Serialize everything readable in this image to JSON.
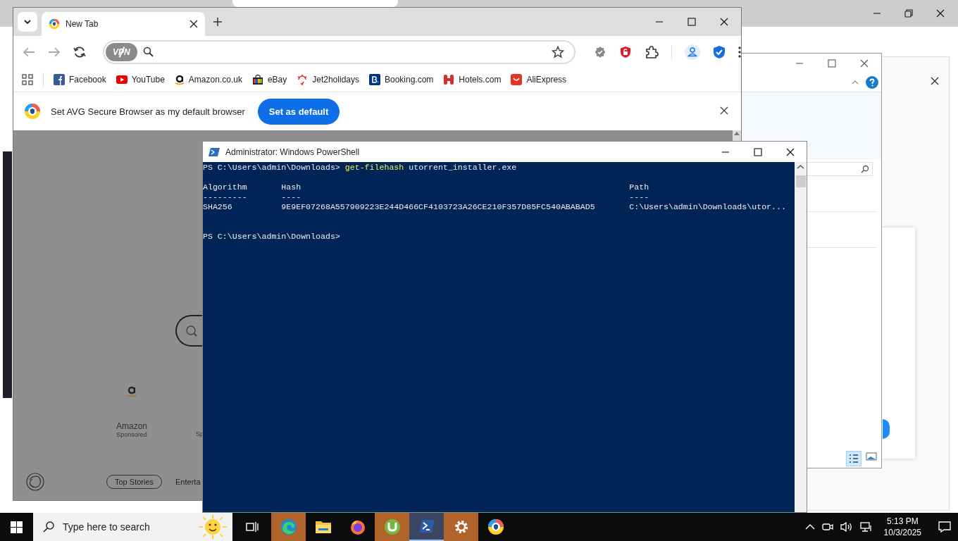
{
  "browser": {
    "tabs": [
      {
        "title": "New Tab",
        "selected": true
      }
    ],
    "vpn_label": "VPN",
    "bookmarks": [
      {
        "kind": "facebook",
        "label": "Facebook"
      },
      {
        "kind": "youtube",
        "label": "YouTube"
      },
      {
        "kind": "amazon",
        "label": "Amazon.co.uk"
      },
      {
        "kind": "ebay",
        "label": "eBay"
      },
      {
        "kind": "jet2",
        "label": "Jet2holidays"
      },
      {
        "kind": "booking",
        "label": "Booking.com"
      },
      {
        "kind": "hotels",
        "label": "Hotels.com"
      },
      {
        "kind": "aliexpress",
        "label": "AliExpress"
      }
    ],
    "infobar": {
      "message": "Set AVG Secure Browser as my default browser",
      "button": "Set as default"
    },
    "newtab": {
      "tiles": [
        {
          "name": "Amazon",
          "note": "Sponsored"
        },
        {
          "note": "Sp"
        }
      ],
      "chips": [
        {
          "label": "Top Stories",
          "selected": true
        },
        {
          "label": "Enterta",
          "selected": false
        }
      ]
    }
  },
  "powershell": {
    "title": "Administrator: Windows PowerShell",
    "command": {
      "prompt": "PS C:\\Users\\admin\\Downloads> ",
      "cmdlet": "get-filehash",
      "args": " utorrent_installer.exe"
    },
    "columns": [
      {
        "header": "Algorithm",
        "rule": "---------"
      },
      {
        "header": "Hash",
        "rule": "----"
      },
      {
        "header": "Path",
        "rule": "----"
      }
    ],
    "rows": [
      [
        "SHA256",
        "9E9EF07268A557909223E244D466CF4103723A26CE210F357D85FC540ABABAD5",
        "C:\\Users\\admin\\Downloads\\utor..."
      ]
    ],
    "prompt": "PS C:\\Users\\admin\\Downloads>"
  },
  "taskbar": {
    "search_placeholder": "Type here to search",
    "apps": [
      {
        "kind": "edge",
        "flashing": true,
        "active": false
      },
      {
        "kind": "explorer",
        "flashing": false,
        "active": false
      },
      {
        "kind": "firefox",
        "flashing": false,
        "active": false
      },
      {
        "kind": "utorrent",
        "flashing": true,
        "active": false
      },
      {
        "kind": "powershell",
        "flashing": false,
        "active": true
      },
      {
        "kind": "settings",
        "flashing": true,
        "active": false
      },
      {
        "kind": "avg",
        "flashing": false,
        "active": false
      }
    ],
    "time": "5:13 PM",
    "date": "10/3/2025"
  }
}
